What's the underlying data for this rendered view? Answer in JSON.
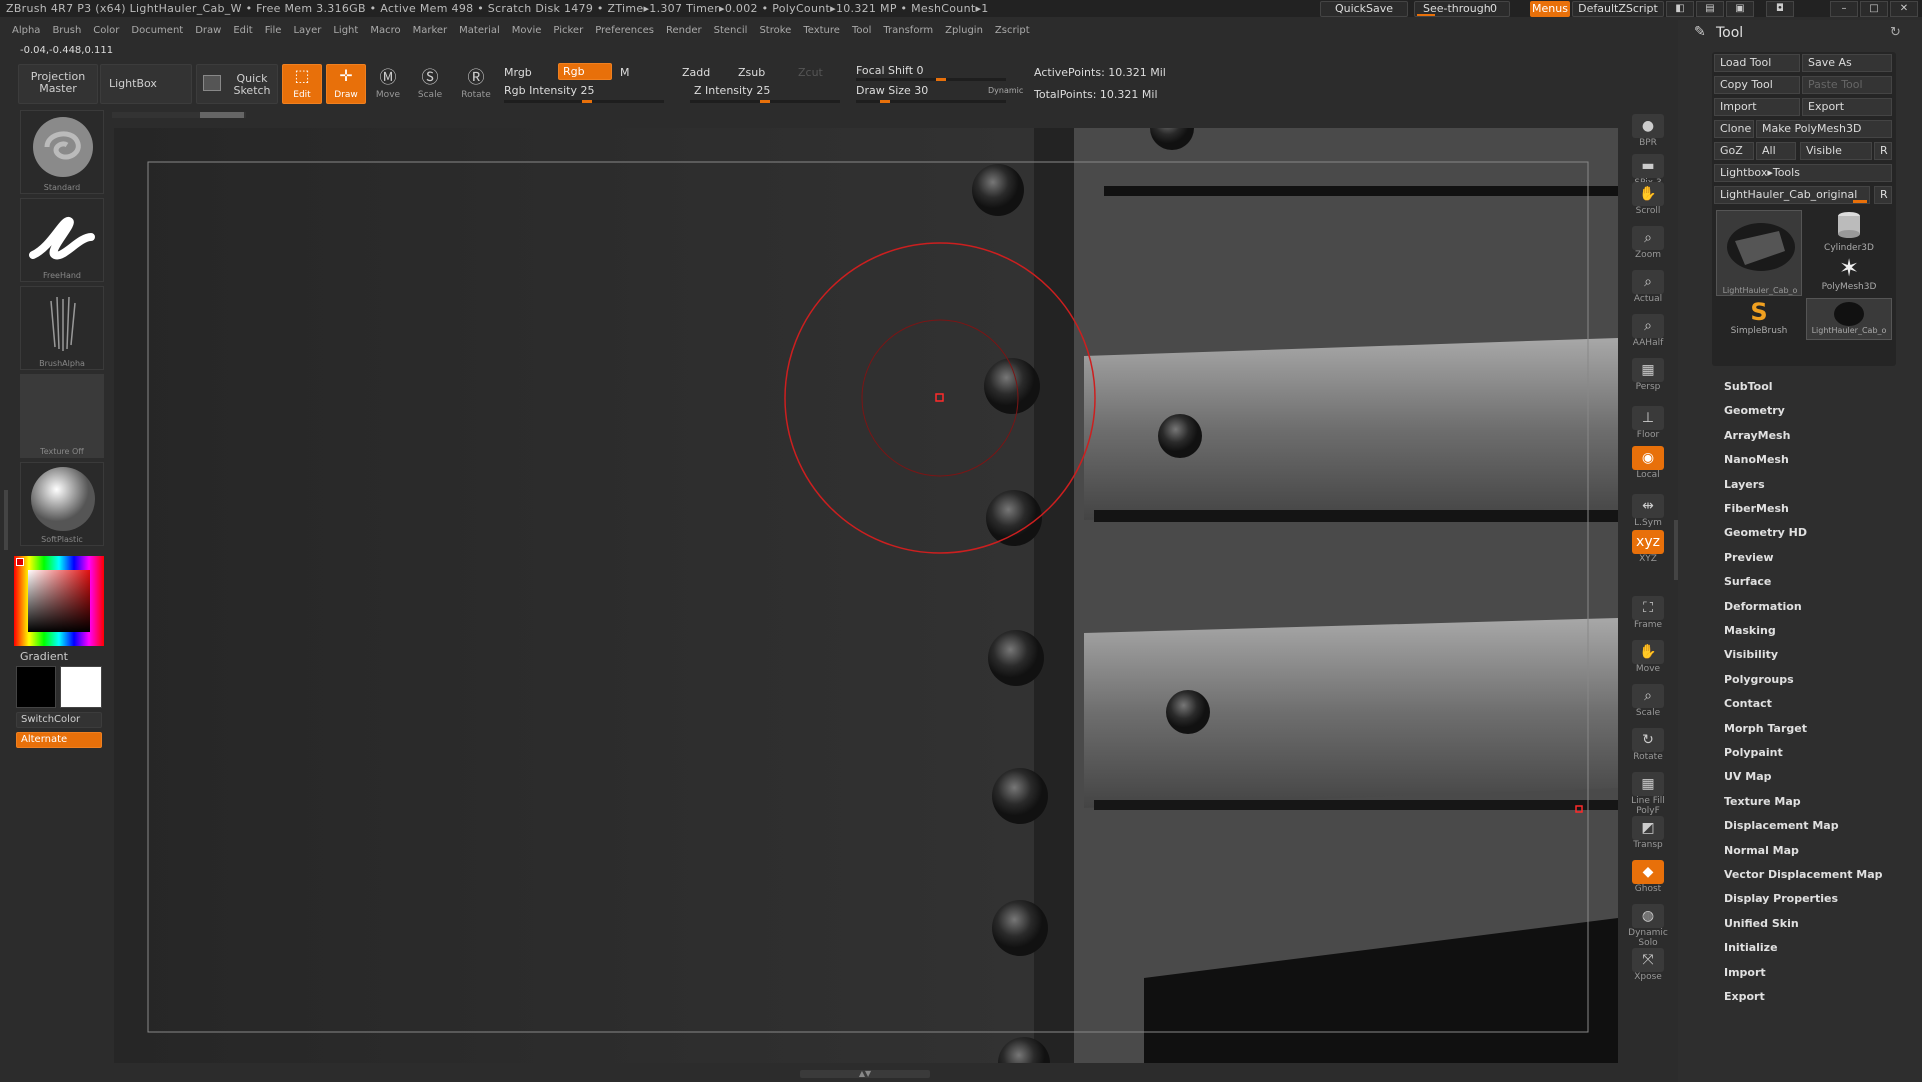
{
  "titlebar": {
    "title": "ZBrush 4R7 P3 (x64)   LightHauler_Cab_W   • Free Mem 3.316GB • Active Mem 498 • Scratch Disk 1479 •  ZTime▸1.307 Timer▸0.002 • PolyCount▸10.321 MP  • MeshCount▸1",
    "quicksave": "QuickSave",
    "see_through": "See-through",
    "see_through_value": "0",
    "menus": "Menus",
    "script": "DefaultZScript"
  },
  "menubar": [
    "Alpha",
    "Brush",
    "Color",
    "Document",
    "Draw",
    "Edit",
    "File",
    "Layer",
    "Light",
    "Macro",
    "Marker",
    "Material",
    "Movie",
    "Picker",
    "Preferences",
    "Render",
    "Stencil",
    "Stroke",
    "Texture",
    "Tool",
    "Transform",
    "Zplugin",
    "Zscript"
  ],
  "coords": "-0.04,-0.448,0.111",
  "toolbar": {
    "projection_master": "Projection Master",
    "lightbox": "LightBox",
    "quick_sketch": "Quick Sketch",
    "edit": "Edit",
    "draw": "Draw",
    "move": "Move",
    "scale": "Scale",
    "rotate": "Rotate",
    "mrgb": "Mrgb",
    "rgb": "Rgb",
    "m": "M",
    "zadd": "Zadd",
    "zsub": "Zsub",
    "zcut": "Zcut",
    "rgb_intensity": "Rgb Intensity 25",
    "z_intensity": "Z Intensity 25",
    "focal_shift": "Focal Shift 0",
    "draw_size": "Draw Size 30",
    "dynamic": "Dynamic",
    "active_points": "ActivePoints: 10.321 Mil",
    "total_points": "TotalPoints: 10.321 Mil"
  },
  "leftshelf": {
    "brush": "Standard",
    "stroke": "FreeHand",
    "alpha": "BrushAlpha",
    "texture": "Texture Off",
    "material": "SoftPlastic",
    "gradient": "Gradient",
    "switch_color": "SwitchColor",
    "alternate": "Alternate",
    "primary_color": "#000000",
    "secondary_color": "#ffffff"
  },
  "rightshelf": [
    {
      "label": "BPR",
      "icon": "sphere-icon"
    },
    {
      "label": "SPix 3",
      "icon": "spix-icon"
    },
    {
      "label": "Scroll",
      "icon": "hand-icon"
    },
    {
      "label": "Zoom",
      "icon": "magnifier-icon"
    },
    {
      "label": "Actual",
      "icon": "actual-icon"
    },
    {
      "label": "AAHalf",
      "icon": "aahalf-icon"
    },
    {
      "label": "Persp",
      "icon": "grid-icon"
    },
    {
      "label": "Floor",
      "icon": "floor-icon"
    },
    {
      "label": "Local",
      "icon": "local-icon"
    },
    {
      "label": "L.Sym",
      "icon": "symmetry-icon"
    },
    {
      "label": "XYZ",
      "icon": "xyz-icon"
    },
    {
      "label": "Frame",
      "icon": "frame-icon"
    },
    {
      "label": "Move",
      "icon": "move-icon"
    },
    {
      "label": "Scale",
      "icon": "scale-icon"
    },
    {
      "label": "Rotate",
      "icon": "rotate-icon"
    },
    {
      "label": "Line Fill PolyF",
      "icon": "polyf-icon"
    },
    {
      "label": "Transp",
      "icon": "transp-icon"
    },
    {
      "label": "Ghost",
      "icon": "ghost-icon"
    },
    {
      "label": "Dynamic Solo",
      "icon": "solo-icon"
    },
    {
      "label": "Xpose",
      "icon": "xpose-icon"
    }
  ],
  "panel": {
    "title": "Tool",
    "load_tool": "Load Tool",
    "save_as": "Save As",
    "copy_tool": "Copy Tool",
    "paste_tool": "Paste Tool",
    "import": "Import",
    "export": "Export",
    "clone": "Clone",
    "make_polymesh": "Make PolyMesh3D",
    "goz": "GoZ",
    "all": "All",
    "visible": "Visible",
    "r": "R",
    "lightbox_tools": "Lightbox▸Tools",
    "current_tool": "LightHauler_Cab_original",
    "tools": [
      "LightHauler_Cab_o",
      "Cylinder3D",
      "PolyMesh3D",
      "SimpleBrush",
      "LightHauler_Cab_o"
    ],
    "menus": [
      "SubTool",
      "Geometry",
      "ArrayMesh",
      "NanoMesh",
      "Layers",
      "FiberMesh",
      "Geometry HD",
      "Preview",
      "Surface",
      "Deformation",
      "Masking",
      "Visibility",
      "Polygroups",
      "Contact",
      "Morph Target",
      "Polypaint",
      "UV Map",
      "Texture Map",
      "Displacement Map",
      "Normal Map",
      "Vector Displacement Map",
      "Display Properties",
      "Unified Skin",
      "Initialize",
      "Import",
      "Export"
    ]
  },
  "colors": {
    "accent": "#e8700a",
    "brush_cursor": "#cc1f1f"
  }
}
